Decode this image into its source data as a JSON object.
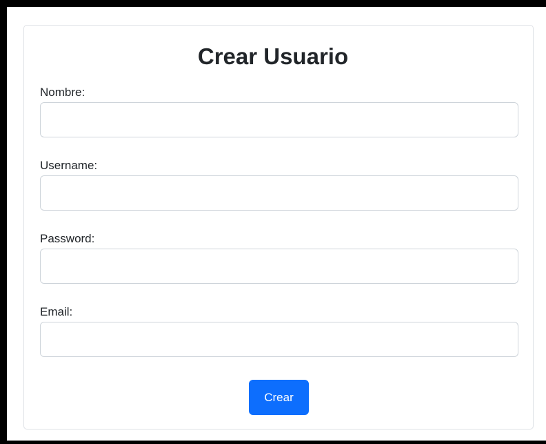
{
  "form": {
    "title": "Crear Usuario",
    "fields": [
      {
        "label": "Nombre:",
        "value": "",
        "placeholder": ""
      },
      {
        "label": "Username:",
        "value": "",
        "placeholder": ""
      },
      {
        "label": "Password:",
        "value": "",
        "placeholder": ""
      },
      {
        "label": "Email:",
        "value": "",
        "placeholder": ""
      }
    ],
    "submit_label": "Crear"
  },
  "colors": {
    "primary_button": "#0d6efd",
    "frame": "#000000",
    "input_border": "#ced4da"
  }
}
